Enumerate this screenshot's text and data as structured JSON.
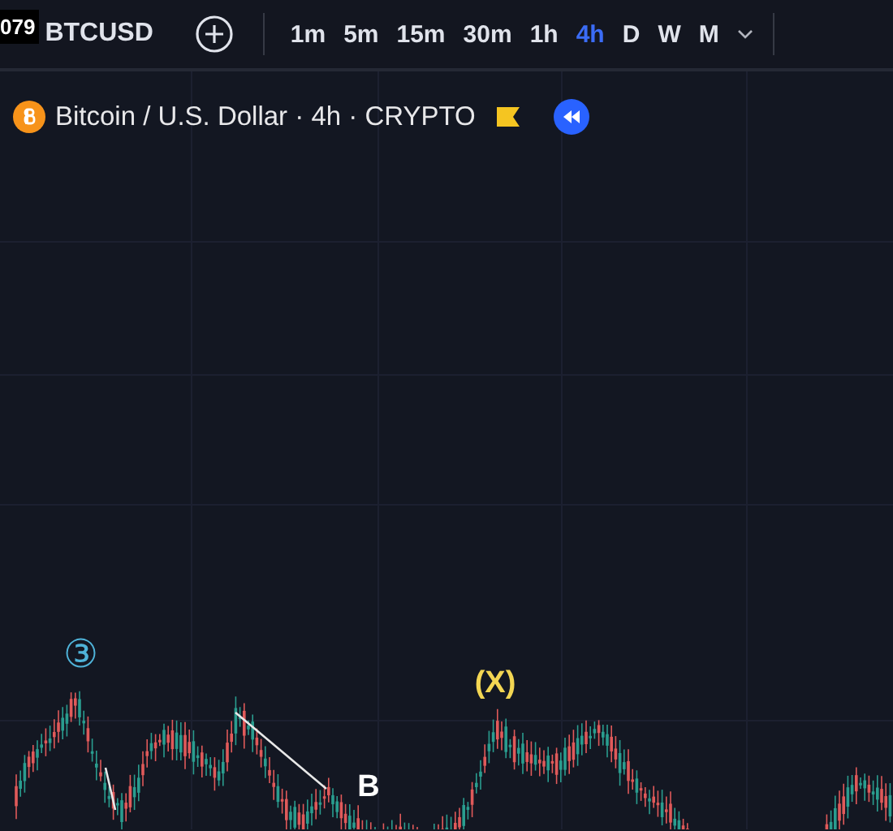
{
  "toolbar": {
    "cut_label": "079",
    "symbol": "BTCUSD",
    "intervals": [
      {
        "label": "1m",
        "selected": false
      },
      {
        "label": "5m",
        "selected": false
      },
      {
        "label": "15m",
        "selected": false
      },
      {
        "label": "30m",
        "selected": false
      },
      {
        "label": "1h",
        "selected": false
      },
      {
        "label": "4h",
        "selected": true
      },
      {
        "label": "D",
        "selected": false
      },
      {
        "label": "W",
        "selected": false
      },
      {
        "label": "M",
        "selected": false
      }
    ]
  },
  "legend": {
    "title": "Bitcoin / U.S. Dollar · 4h · CRYPTO"
  },
  "chart": {
    "wave_labels": [
      {
        "text": "③",
        "color": "#4fb3d9",
        "kind": "circled"
      },
      {
        "text": "(X)",
        "color": "#f3d653",
        "kind": "plain"
      },
      {
        "text": "B",
        "color": "#ffffff",
        "kind": "plain"
      }
    ]
  }
}
